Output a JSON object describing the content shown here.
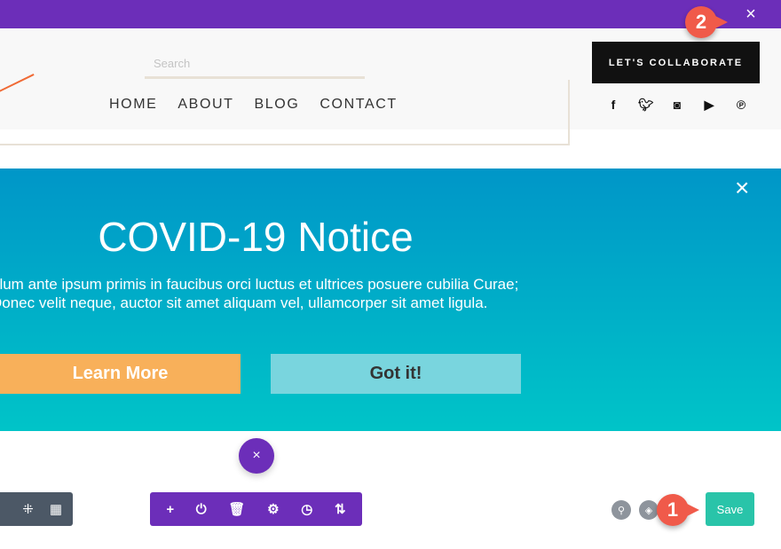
{
  "topbar": {
    "close_icon": "×"
  },
  "header": {
    "search_placeholder": "Search",
    "nav": [
      "HOME",
      "ABOUT",
      "BLOG",
      "CONTACT"
    ],
    "cta": "LET'S COLLABORATE",
    "social": [
      "f",
      "t",
      "ig",
      "yt",
      "p"
    ]
  },
  "banner": {
    "title": "COVID-19 Notice",
    "lines": [
      "ulum ante ipsum primis in faucibus orci luctus et ultrices posuere cubilia Curae;",
      "Donec velit neque, auctor sit amet aliquam vel, ullamcorper sit amet ligula."
    ],
    "learn_more": "Learn More",
    "got_it": "Got it!",
    "close_icon": "×",
    "colors": {
      "top": "#0096c8",
      "bottom": "#00c4c8",
      "learn": "#f8b05a",
      "got": "#79d5de"
    }
  },
  "builder": {
    "close": "×",
    "left_tools": [
      "⁜",
      "▦"
    ],
    "tools": [
      "+",
      "⏻",
      "🗑",
      "⚙",
      "◷",
      "⇅"
    ],
    "save": "Save",
    "accent": "#6c2eb9",
    "save_color": "#29c4a9"
  },
  "annotations": {
    "one": "1",
    "two": "2"
  }
}
